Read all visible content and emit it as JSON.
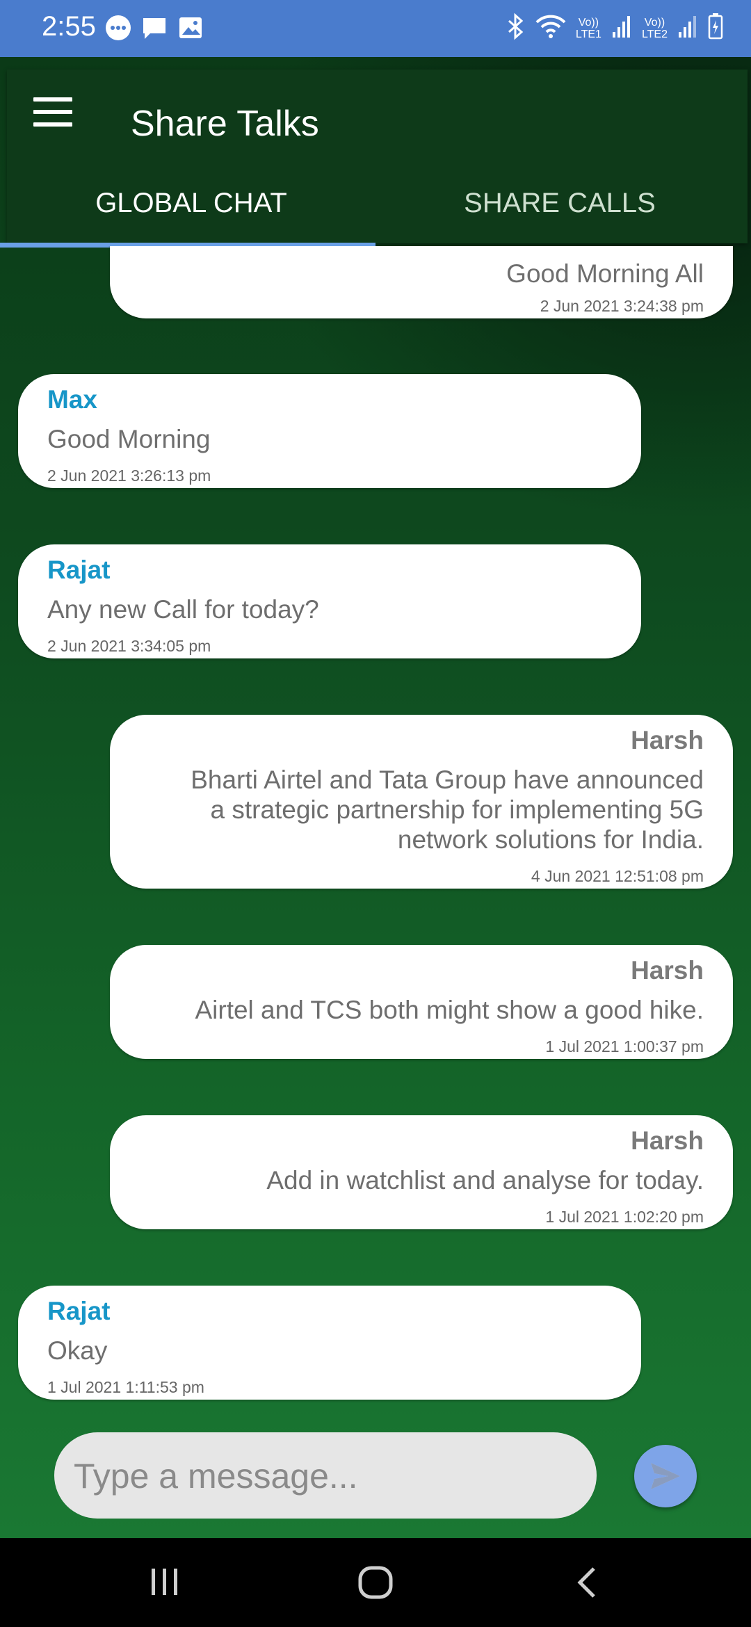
{
  "status_bar": {
    "time": "2:55",
    "lte1": "LTE1",
    "lte2": "LTE2",
    "volte": "Vo))"
  },
  "app_bar": {
    "title": "Share Talks",
    "tabs": [
      {
        "label": "GLOBAL CHAT",
        "selected": true
      },
      {
        "label": "SHARE CALLS",
        "selected": false
      }
    ]
  },
  "messages": [
    {
      "side": "right",
      "sender": "",
      "text": "Good Morning All",
      "time": "2 Jun 2021 3:24:38 pm"
    },
    {
      "side": "left",
      "sender": "Max",
      "text": "Good Morning",
      "time": "2 Jun 2021 3:26:13 pm"
    },
    {
      "side": "left",
      "sender": "Rajat",
      "text": "Any new Call for today?",
      "time": "2 Jun 2021 3:34:05 pm"
    },
    {
      "side": "right",
      "sender": "Harsh",
      "text": "Bharti Airtel and Tata Group have announced a strategic partnership for implementing 5G network solutions for India.",
      "time": "4 Jun 2021 12:51:08 pm"
    },
    {
      "side": "right",
      "sender": "Harsh",
      "text": "Airtel and TCS both might show a good hike.",
      "time": "1 Jul 2021 1:00:37 pm"
    },
    {
      "side": "right",
      "sender": "Harsh",
      "text": "Add in watchlist and analyse for today.",
      "time": "1 Jul 2021 1:02:20 pm"
    },
    {
      "side": "left",
      "sender": "Rajat",
      "text": "Okay",
      "time": "1 Jul 2021 1:11:53 pm"
    }
  ],
  "composer": {
    "placeholder": "Type a message...",
    "value": ""
  },
  "colors": {
    "status_bar": "#4a7ccd",
    "app_bar": "#0e3a19",
    "sender_left": "#1796c8",
    "sender_right": "#7a7a7a",
    "send_button": "#7ea4e8",
    "tab_indicator": "#6aa0e6"
  }
}
